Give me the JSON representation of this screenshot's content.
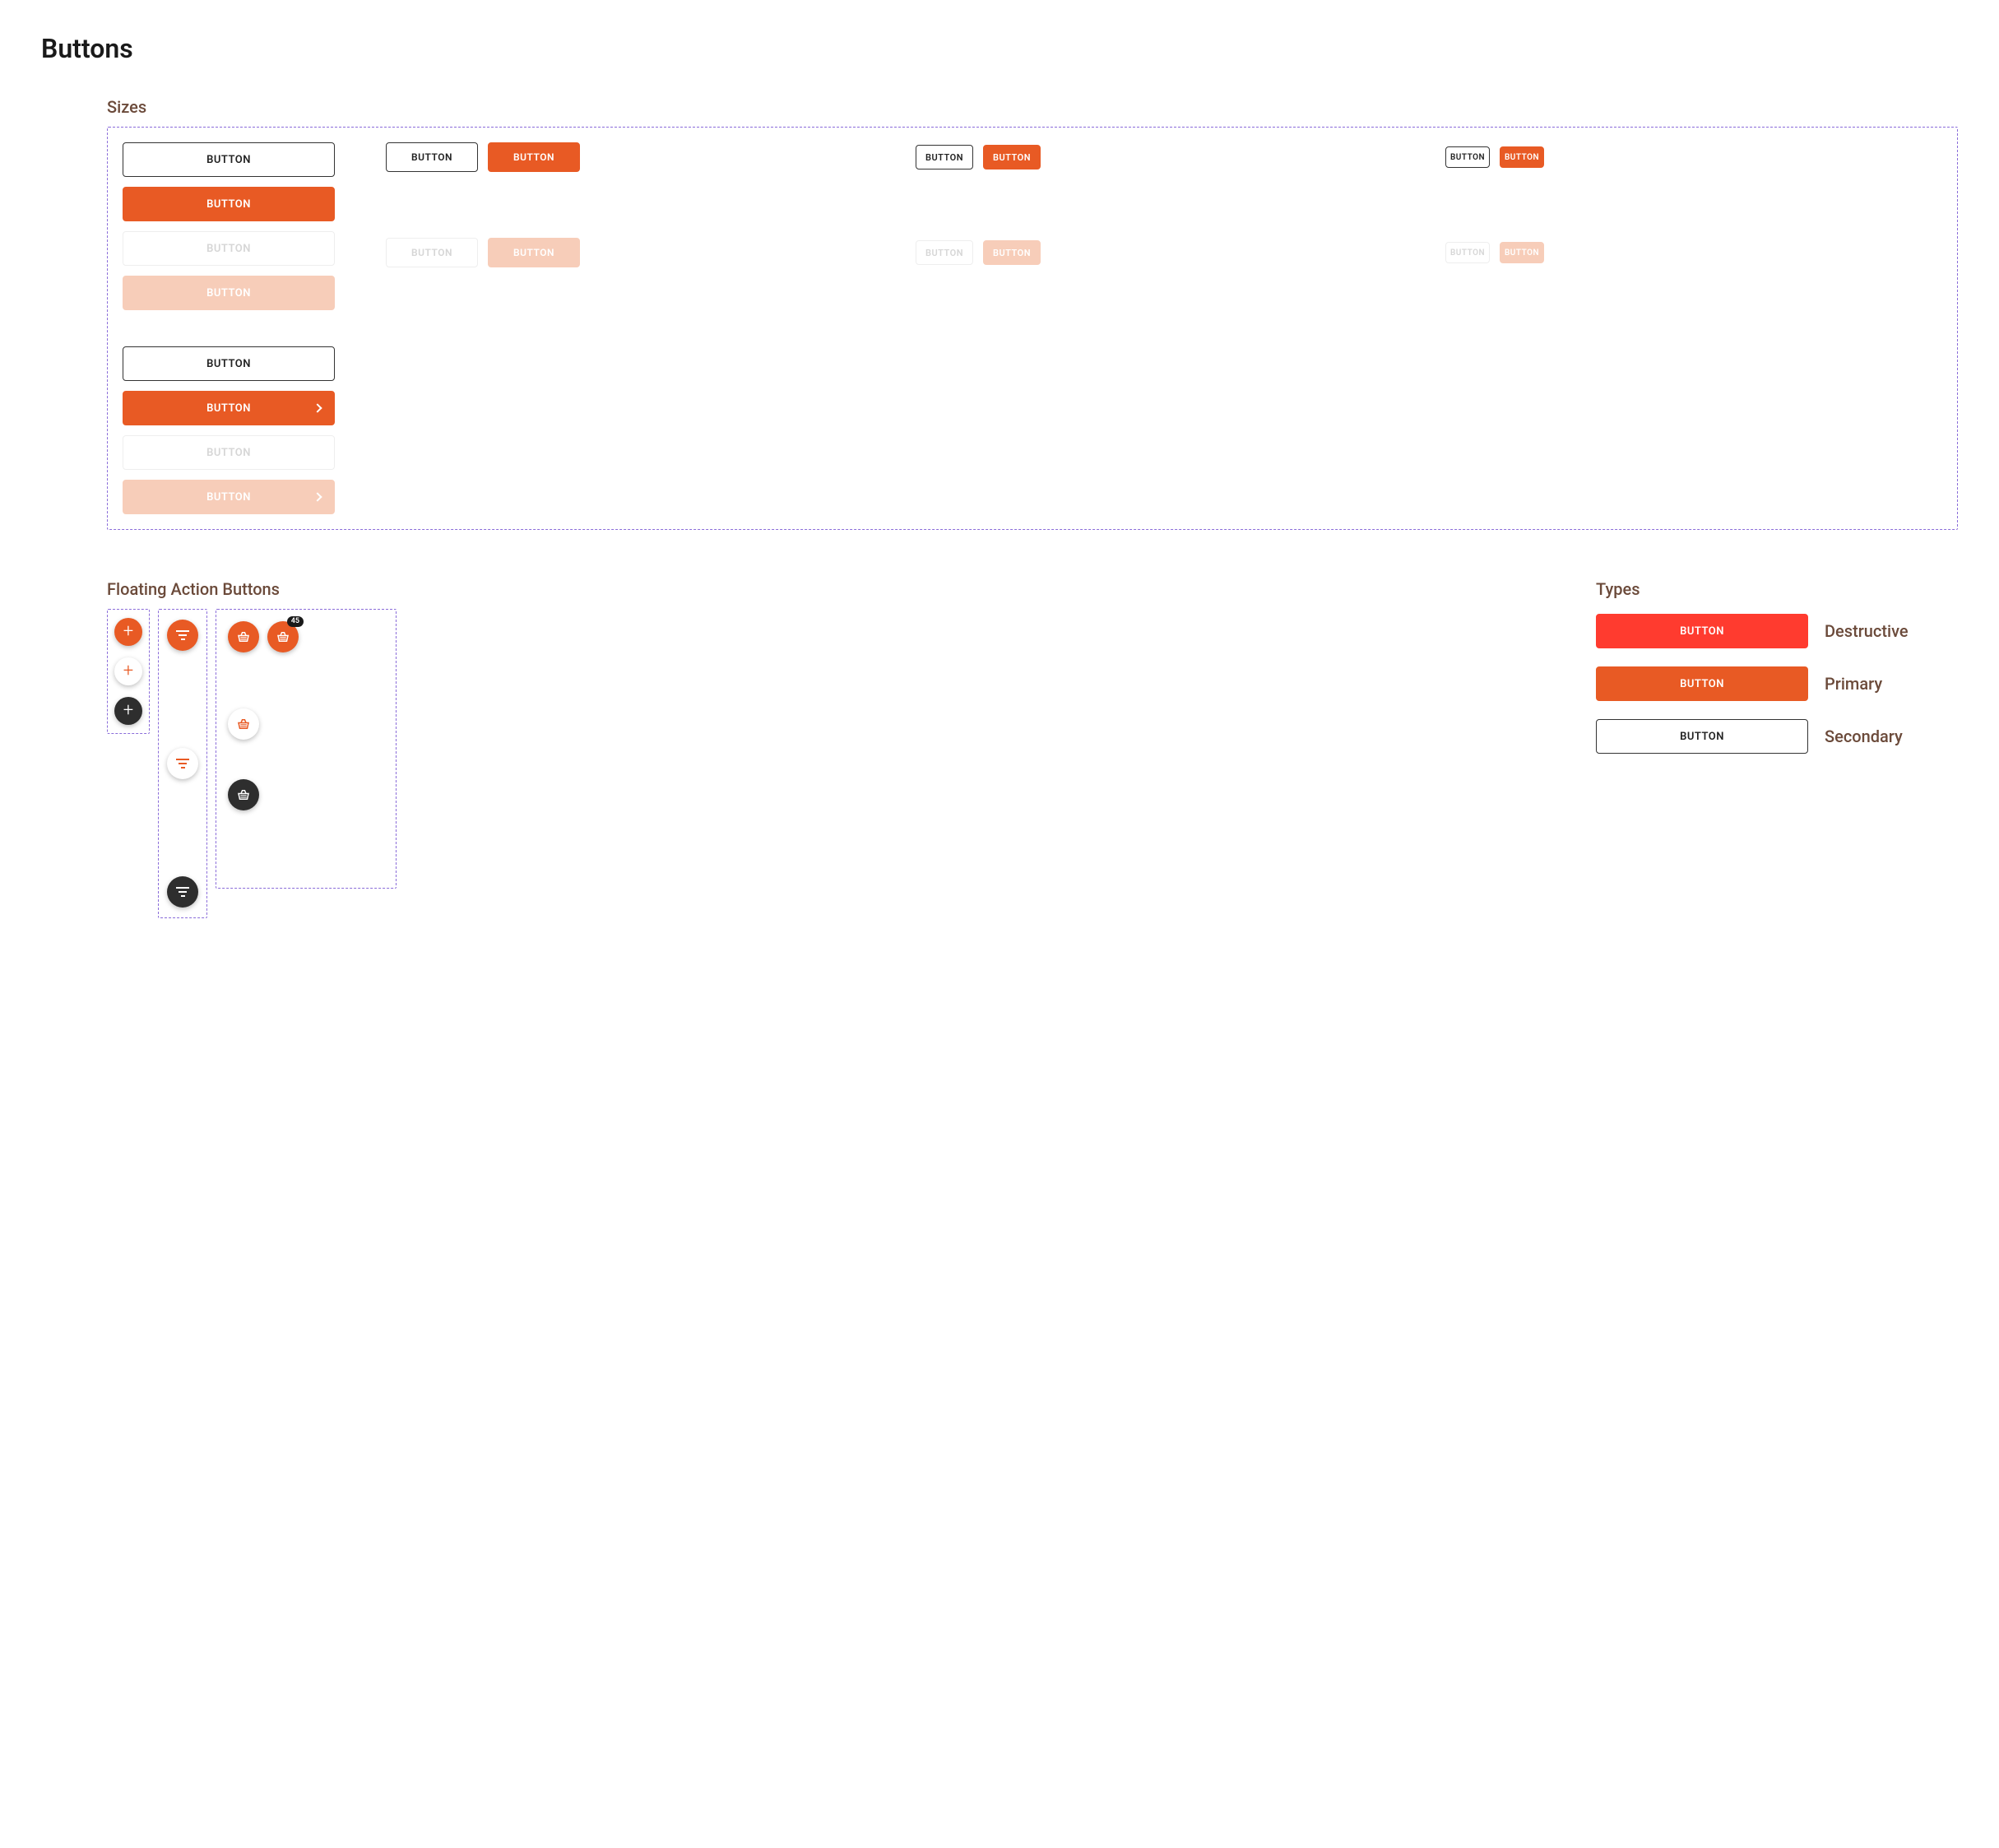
{
  "page_title": "Buttons",
  "sections": {
    "sizes": {
      "label": "Sizes"
    },
    "fab": {
      "label": "Floating Action Buttons"
    },
    "types": {
      "label": "Types"
    }
  },
  "button_label": "BUTTON",
  "badge_value": "45",
  "types": {
    "destructive": {
      "label": "Destructive",
      "button": "BUTTON"
    },
    "primary": {
      "label": "Primary",
      "button": "BUTTON"
    },
    "secondary": {
      "label": "Secondary",
      "button": "BUTTON"
    }
  },
  "colors": {
    "primary": "#e85a24",
    "destructive": "#ff3b2f",
    "dark": "#2e2e2e"
  }
}
